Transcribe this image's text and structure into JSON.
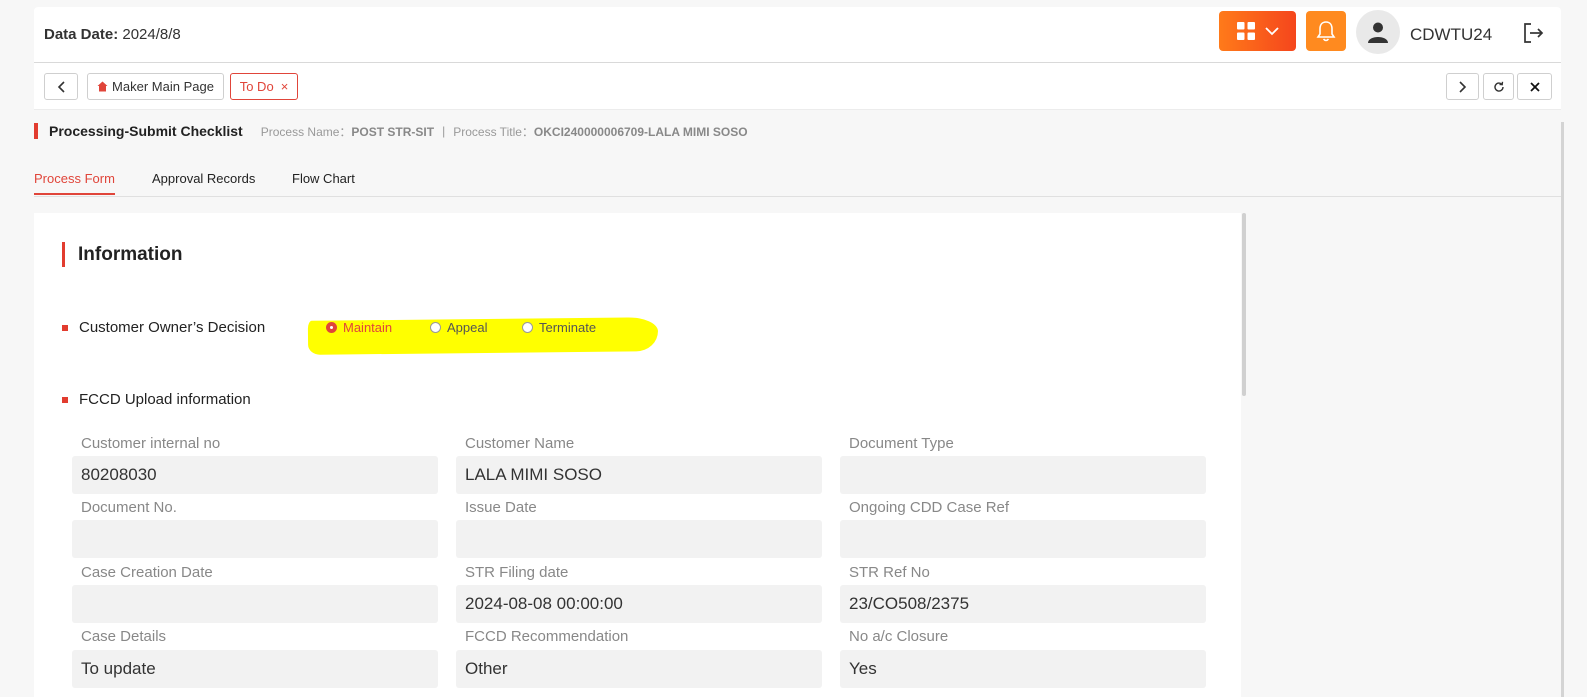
{
  "header": {
    "data_date_label": "Data Date:",
    "data_date_value": "2024/8/8",
    "username": "CDWTU24"
  },
  "tabbar": {
    "home_tab": "Maker Main Page",
    "active_tab": "To Do",
    "active_tab_close": "×"
  },
  "process": {
    "title": "Processing-Submit Checklist",
    "name_label": "Process Name：",
    "name_value": "POST STR-SIT",
    "separator": "|",
    "title_label": "Process Title：",
    "title_value": "OKCI240000006709-LALA MIMI SOSO"
  },
  "main_tabs": [
    {
      "label": "Process Form",
      "active": true
    },
    {
      "label": "Approval Records",
      "active": false
    },
    {
      "label": "Flow Chart",
      "active": false
    }
  ],
  "form": {
    "section_title": "Information",
    "decision": {
      "label": "Customer Owner’s Decision",
      "options": [
        "Maintain",
        "Appeal",
        "Terminate"
      ],
      "selected": "Maintain"
    },
    "upload_label": "FCCD Upload information",
    "fields": [
      {
        "label": "Customer internal no",
        "value": "80208030"
      },
      {
        "label": "Customer Name",
        "value": "LALA MIMI SOSO"
      },
      {
        "label": "Document Type",
        "value": ""
      },
      {
        "label": "Document No.",
        "value": ""
      },
      {
        "label": "Issue Date",
        "value": ""
      },
      {
        "label": "Ongoing CDD Case Ref",
        "value": ""
      },
      {
        "label": "Case Creation Date",
        "value": ""
      },
      {
        "label": "STR Filing date",
        "value": "2024-08-08 00:00:00"
      },
      {
        "label": "STR Ref No",
        "value": "23/CO508/2375"
      },
      {
        "label": "Case Details",
        "value": "To update"
      },
      {
        "label": "FCCD Recommendation",
        "value": "Other"
      },
      {
        "label": "No a/c Closure",
        "value": "Yes"
      }
    ]
  },
  "colors": {
    "accent": "#e0453a",
    "apps_button": "#ff7a1a",
    "bell_button": "#ff8a1f",
    "highlight": "#ffff00"
  }
}
